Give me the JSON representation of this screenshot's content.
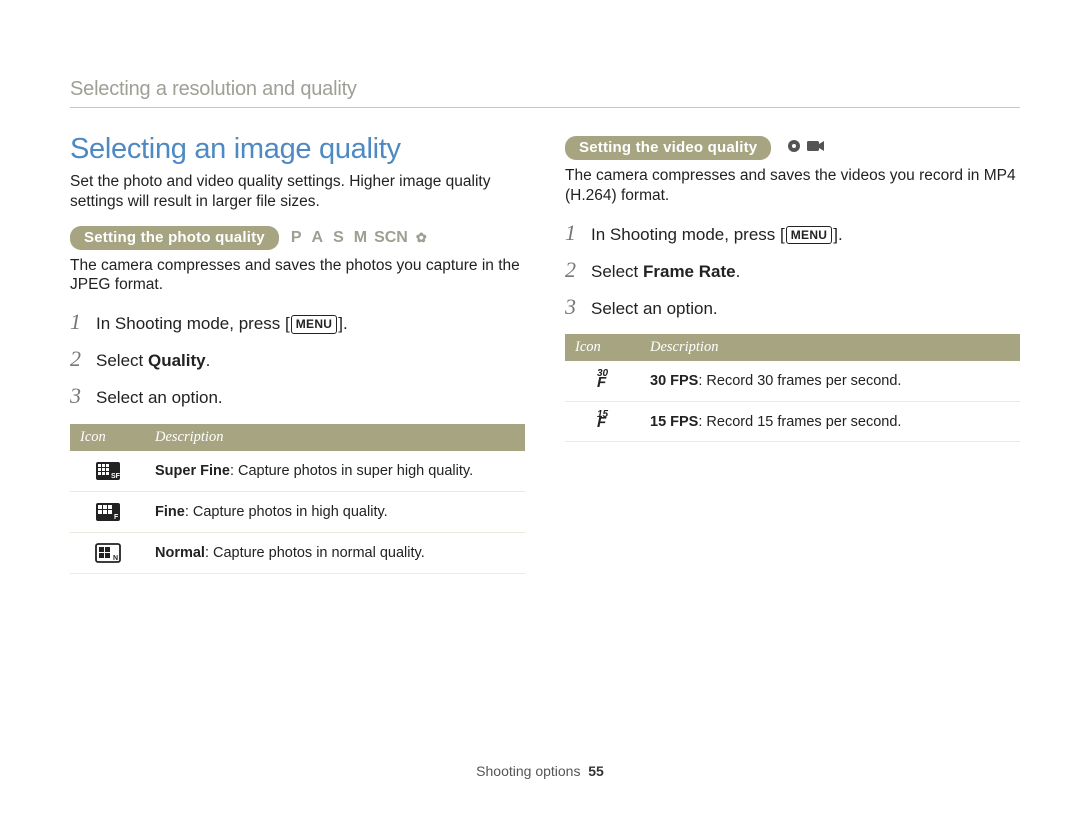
{
  "breadcrumb": "Selecting a resolution and quality",
  "section_title": "Selecting an image quality",
  "intro": "Set the photo and video quality settings. Higher image quality settings will result in larger file sizes.",
  "photo": {
    "pill": "Setting the photo quality",
    "modes": {
      "p": "P",
      "a": "A",
      "s": "S",
      "m": "M",
      "scn": "SCN"
    },
    "desc": "The camera compresses and saves the photos you capture in the JPEG format.",
    "steps": {
      "s1a": "In Shooting mode, press [",
      "s1b": "].",
      "s2a": "Select ",
      "s2b": "Quality",
      "s2c": ".",
      "s3": "Select an option."
    },
    "table_headers": {
      "icon": "Icon",
      "desc": "Description"
    },
    "rows": [
      {
        "bold": "Super Fine",
        "rest": ": Capture photos in super high quality."
      },
      {
        "bold": "Fine",
        "rest": ": Capture photos in high quality."
      },
      {
        "bold": "Normal",
        "rest": ": Capture photos in normal quality."
      }
    ]
  },
  "video": {
    "pill": "Setting the video quality",
    "desc": "The camera compresses and saves the videos you record in MP4 (H.264) format.",
    "steps": {
      "s1a": "In Shooting mode, press [",
      "s1b": "].",
      "s2a": "Select ",
      "s2b": "Frame Rate",
      "s2c": ".",
      "s3": "Select an option."
    },
    "table_headers": {
      "icon": "Icon",
      "desc": "Description"
    },
    "rows": [
      {
        "fps_n": "30",
        "bold": "30 FPS",
        "rest": ": Record 30 frames per second."
      },
      {
        "fps_n": "15",
        "bold": "15 FPS",
        "rest": ": Record 15 frames per second."
      }
    ]
  },
  "menu_label": "MENU",
  "footer": {
    "label": "Shooting options",
    "page": "55"
  }
}
